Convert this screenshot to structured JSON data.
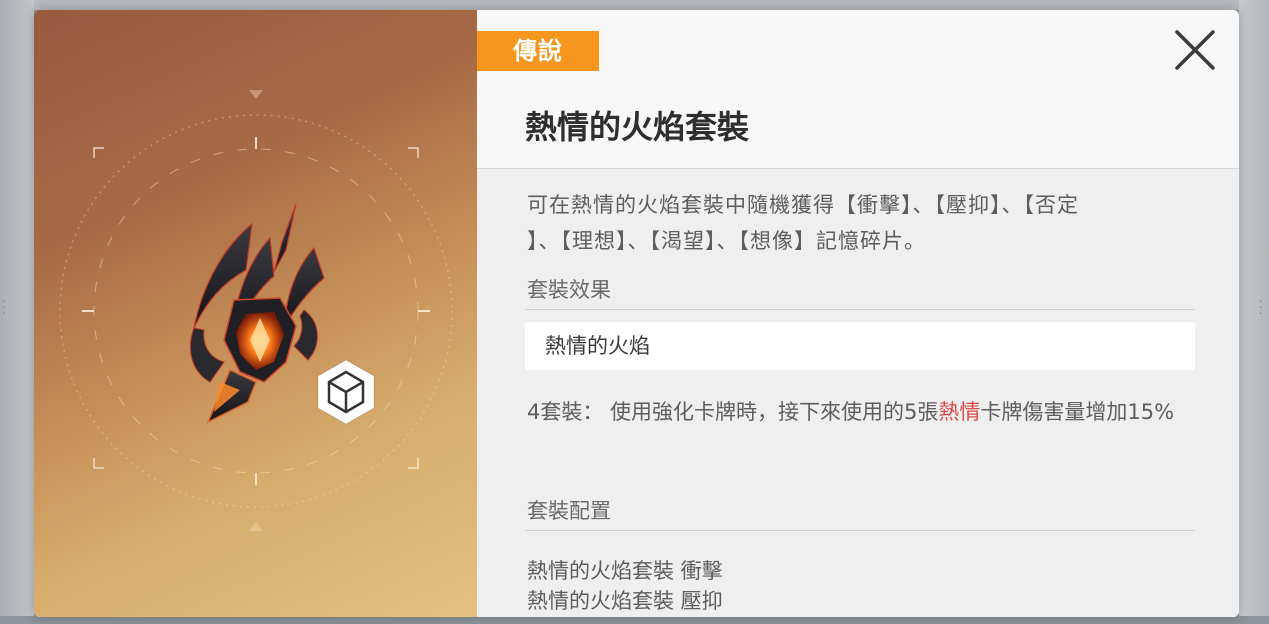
{
  "modal": {
    "rarity": "傳說",
    "title": "熱情的火焰套裝",
    "description_line1": "可在熱情的火焰套裝中隨機獲得【衝擊】、【壓抑】、【否定",
    "description_line2": "】、【理想】、【渴望】、【想像】記憶碎片。",
    "set_effect_label": "套裝效果",
    "set_effect_name": "熱情的火焰",
    "set_effect_desc_prefix": "4套裝： 使用強化卡牌時，接下來使用的5張",
    "set_effect_desc_highlight": "熱情",
    "set_effect_desc_suffix": "卡牌傷害量增加15%",
    "set_config_label": "套裝配置",
    "set_config_items": [
      "熱情的火焰套裝 衝擊",
      "熱情的火焰套裝 壓抑"
    ]
  },
  "icons": {
    "close": "close-icon",
    "item_type": "cube-icon",
    "item_art": "flame-crystal-art"
  },
  "colors": {
    "rarity_badge": "#f7961f",
    "highlight": "#e04848",
    "panel_bg": "#efeff0"
  }
}
